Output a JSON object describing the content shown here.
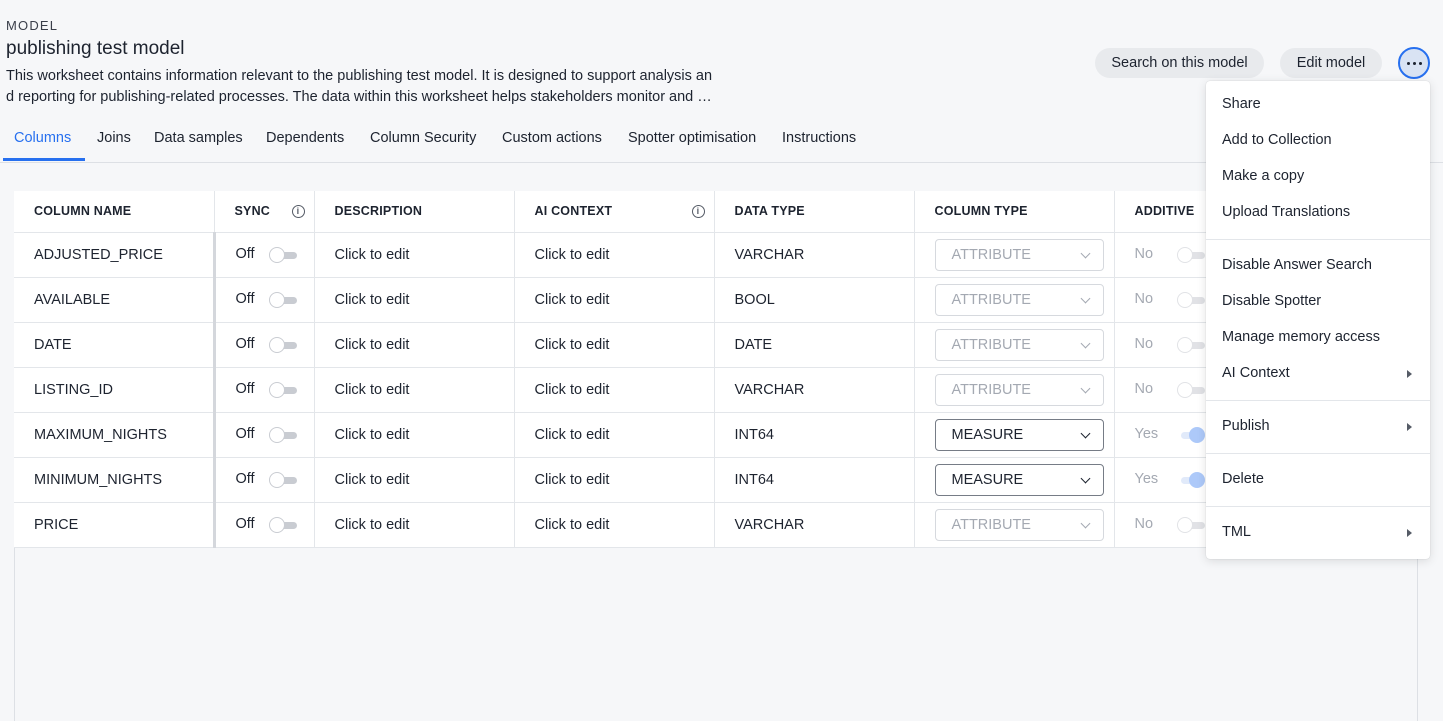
{
  "header": {
    "kicker": "MODEL",
    "title": "publishing test model",
    "description": "This worksheet contains information relevant to the publishing test model. It is designed to support analysis and reporting for publishing-related processes. The data within this worksheet helps stakeholders monitor and evaluate",
    "search_button": "Search on this model",
    "edit_button": "Edit model",
    "more_icon": "more-horizontal-icon"
  },
  "tabs": [
    "Columns",
    "Joins",
    "Data samples",
    "Dependents",
    "Column Security",
    "Custom actions",
    "Spotter optimisation",
    "Instructions"
  ],
  "table": {
    "headers": {
      "column_name": "COLUMN NAME",
      "sync": "SYNC",
      "description": "DESCRIPTION",
      "ai_context": "AI CONTEXT",
      "data_type": "DATA TYPE",
      "column_type": "COLUMN TYPE",
      "additive": "ADDITIVE"
    },
    "rows": [
      {
        "name": "ADJUSTED_PRICE",
        "sync": "Off",
        "description": "Click to edit",
        "ai_context": "Click to edit",
        "data_type": "VARCHAR",
        "column_type": "ATTRIBUTE",
        "additive": "No"
      },
      {
        "name": "AVAILABLE",
        "sync": "Off",
        "description": "Click to edit",
        "ai_context": "Click to edit",
        "data_type": "BOOL",
        "column_type": "ATTRIBUTE",
        "additive": "No"
      },
      {
        "name": "DATE",
        "sync": "Off",
        "description": "Click to edit",
        "ai_context": "Click to edit",
        "data_type": "DATE",
        "column_type": "ATTRIBUTE",
        "additive": "No"
      },
      {
        "name": "LISTING_ID",
        "sync": "Off",
        "description": "Click to edit",
        "ai_context": "Click to edit",
        "data_type": "VARCHAR",
        "column_type": "ATTRIBUTE",
        "additive": "No"
      },
      {
        "name": "MAXIMUM_NIGHTS",
        "sync": "Off",
        "description": "Click to edit",
        "ai_context": "Click to edit",
        "data_type": "INT64",
        "column_type": "MEASURE",
        "additive": "Yes"
      },
      {
        "name": "MINIMUM_NIGHTS",
        "sync": "Off",
        "description": "Click to edit",
        "ai_context": "Click to edit",
        "data_type": "INT64",
        "column_type": "MEASURE",
        "additive": "Yes"
      },
      {
        "name": "PRICE",
        "sync": "Off",
        "description": "Click to edit",
        "ai_context": "Click to edit",
        "data_type": "VARCHAR",
        "column_type": "ATTRIBUTE",
        "additive": "No"
      }
    ]
  },
  "menu": {
    "items": [
      "Share",
      "Add to Collection",
      "Make a copy",
      "Upload Translations",
      "Disable Answer Search",
      "Disable Spotter",
      "Manage memory access",
      "AI Context",
      "Publish",
      "Delete",
      "TML"
    ]
  },
  "colors": {
    "accent": "#2770ef",
    "background": "#f6f7f9"
  }
}
